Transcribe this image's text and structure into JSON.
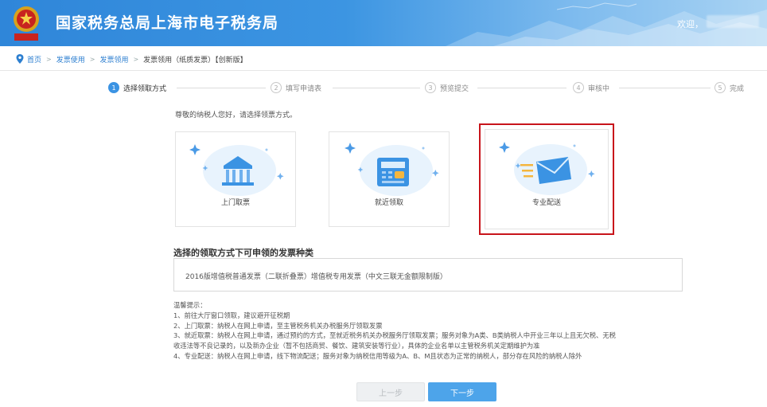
{
  "header": {
    "site_title": "国家税务总局上海市电子税务局",
    "welcome": "欢迎，",
    "emblem_text": "中国税务"
  },
  "breadcrumb": [
    {
      "label": "首页"
    },
    {
      "label": "发票使用"
    },
    {
      "label": "发票领用"
    },
    {
      "label": "发票领用（纸质发票）【创新版】"
    }
  ],
  "steps": [
    {
      "num": "1",
      "label": "选择领取方式",
      "active": true
    },
    {
      "num": "2",
      "label": "填写申请表",
      "active": false
    },
    {
      "num": "3",
      "label": "预览提交",
      "active": false
    },
    {
      "num": "4",
      "label": "审核中",
      "active": false
    },
    {
      "num": "5",
      "label": "完成",
      "active": false
    }
  ],
  "greeting": "尊敬的纳税人您好，请选择领票方式。",
  "options": [
    {
      "label": "上门取票",
      "icon": "bank-icon",
      "selected": false
    },
    {
      "label": "就近领取",
      "icon": "terminal-icon",
      "selected": false
    },
    {
      "label": "专业配送",
      "icon": "envelope-delivery-icon",
      "selected": true
    }
  ],
  "invoice_types": {
    "title": "选择的领取方式下可申领的发票种类",
    "value": "2016版增值税普通发票（二联折叠票）增值税专用发票（中文三联无金额限制版）"
  },
  "tips": [
    "温馨提示：",
    "1、前往大厅窗口领取，建议避开征税期",
    "2、上门取票：纳税人在网上申请，至主管税务机关办税服务厅领取发票",
    "3、就近取票：纳税人在网上申请，通过预约的方式，至就近税务机关办税服务厅领取发票；服务对象为A类、B类纳税人中开业三年以上且无欠税、无税",
    "收违法等不良记录的，以及新办企业（暂不包括商贸、餐饮、建筑安装等行业），具体的企业名单以主管税务机关定期维护为准",
    "4、专业配送：纳税人在网上申请，线下物流配送；服务对象为纳税信用等级为A、B、M且状态为正常的纳税人，部分存在风险的纳税人除外"
  ],
  "buttons": {
    "prev": "上一步",
    "next": "下一步"
  },
  "colors": {
    "header_blue": "#2f86d9",
    "accent": "#3b93e3",
    "selection_red": "#c8141b"
  }
}
